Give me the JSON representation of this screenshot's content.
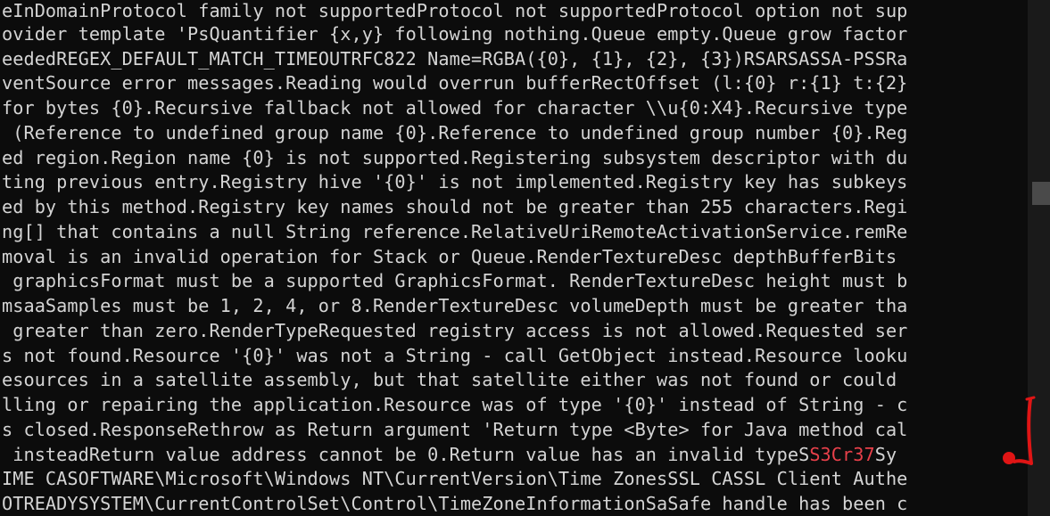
{
  "console": {
    "lines": [
      {
        "text": "eInDomainProtocol family not supportedProtocol not supportedProtocol option not sup"
      },
      {
        "text": "ovider template 'PsQuantifier {x,y} following nothing.Queue empty.Queue grow factor"
      },
      {
        "text": "eededREGEX_DEFAULT_MATCH_TIMEOUTRFC822 Name=RGBA({0}, {1}, {2}, {3})RSARSASSA-PSSRa"
      },
      {
        "text": "ventSource error messages.Reading would overrun bufferRectOffset (l:{0} r:{1} t:{2}"
      },
      {
        "text": "for bytes {0}.Recursive fallback not allowed for character \\\\u{0:X4}.Recursive type"
      },
      {
        "text": " (Reference to undefined group name {0}.Reference to undefined group number {0}.Reg"
      },
      {
        "text": "ed region.Region name {0} is not supported.Registering subsystem descriptor with du"
      },
      {
        "text": "ting previous entry.Registry hive '{0}' is not implemented.Registry key has subkeys"
      },
      {
        "text": "ed by this method.Registry key names should not be greater than 255 characters.Regi"
      },
      {
        "text": "ng[] that contains a null String reference.RelativeUriRemoteActivationService.remRe"
      },
      {
        "text": "moval is an invalid operation for Stack or Queue.RenderTextureDesc depthBufferBits "
      },
      {
        "text": " graphicsFormat must be a supported GraphicsFormat. RenderTextureDesc height must b"
      },
      {
        "text": "msaaSamples must be 1, 2, 4, or 8.RenderTextureDesc volumeDepth must be greater tha"
      },
      {
        "text": " greater than zero.RenderTypeRequested registry access is not allowed.Requested ser"
      },
      {
        "text": "s not found.Resource '{0}' was not a String - call GetObject instead.Resource looku"
      },
      {
        "text": "esources in a satellite assembly, but that satellite either was not found or could "
      },
      {
        "text": "lling or repairing the application.Resource was of type '{0}' instead of String - c"
      },
      {
        "text": "s closed.ResponseRethrow as Return argument 'Return type <Byte> for Java method cal"
      },
      {
        "text": " insteadReturn value address cannot be 0.Return value has an invalid typeS",
        "highlight": "S3Cr37",
        "suffix": "Sy"
      },
      {
        "text": "IME CASOFTWARE\\Microsoft\\Windows NT\\CurrentVersion\\Time ZonesSSL CASSL Client Authe"
      },
      {
        "text": "OTREADYSYSTEM\\CurrentControlSet\\Control\\TimeZoneInformationSaSafe handle has been c"
      }
    ]
  },
  "colors": {
    "background": "#0c0c0c",
    "text": "#d4d4d4",
    "highlight": "#e8404a",
    "annotation": "#e01515"
  }
}
